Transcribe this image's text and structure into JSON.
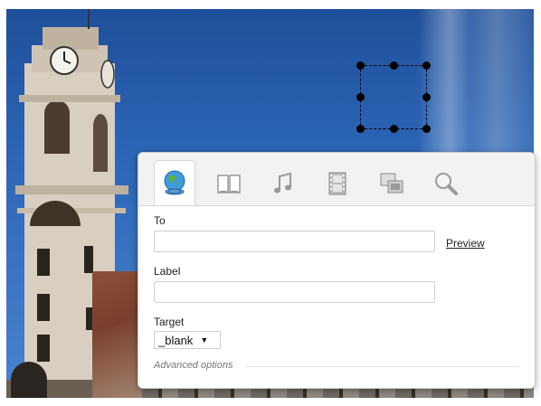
{
  "dialog": {
    "tabs": [
      {
        "icon": "globe-link-icon",
        "active": true
      },
      {
        "icon": "book-icon",
        "active": false
      },
      {
        "icon": "music-note-icon",
        "active": false
      },
      {
        "icon": "film-strip-icon",
        "active": false
      },
      {
        "icon": "image-stack-icon",
        "active": false
      },
      {
        "icon": "magnifier-icon",
        "active": false
      }
    ],
    "to_label": "To",
    "to_value": "",
    "preview_label": "Preview",
    "label_label": "Label",
    "label_value": "",
    "target_label": "Target",
    "target_value": "_blank",
    "advanced_label": "Advanced options"
  },
  "colors": {
    "sky": "#2b64b4",
    "dialog_bg": "#ffffff",
    "tabbar_bg": "#f2f2f2"
  }
}
